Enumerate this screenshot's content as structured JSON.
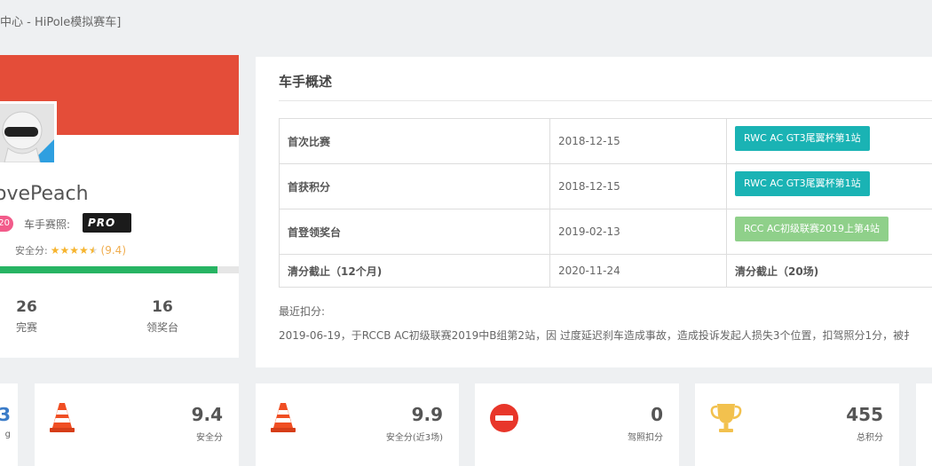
{
  "page_title": "中心 - HiPole模拟赛车]",
  "profile": {
    "username": "ovePeach",
    "level": "20",
    "license_label": "车手赛照:",
    "license_badge": "PRO",
    "safety_label": "安全分:",
    "safety_score_text": "(9.4)",
    "safety_stars": 4.5,
    "progress_fraction": 0.91,
    "stats": [
      {
        "value": "26",
        "label": "完赛"
      },
      {
        "value": "16",
        "label": "领奖台"
      }
    ]
  },
  "overview": {
    "title": "车手概述",
    "rows": [
      {
        "label": "首次比赛",
        "date": "2018-12-15",
        "event": "RWC AC GT3尾翼杯第1站",
        "event_color": "#1ab3b4"
      },
      {
        "label": "首获积分",
        "date": "2018-12-15",
        "event": "RWC AC GT3尾翼杯第1站",
        "event_color": "#1ab3b4"
      },
      {
        "label": "首登领奖台",
        "date": "2019-02-13",
        "event": "RCC AC初级联赛2019上第4站",
        "event_color": "#8fd08a"
      },
      {
        "label": "清分截止（12个月)",
        "date": "2020-11-24",
        "note": "清分截止（20场)"
      }
    ],
    "recent_label": "最近扣分:",
    "recent_text": "2019-06-19，于RCCB AC初级联赛2019中B组第2站，因 过度延迟刹车造成事故，造成投诉发起人损失3个位置，扣驾照分1分，被扌"
  },
  "bottom_cards": [
    {
      "value": "3",
      "label": "g",
      "icon": "none"
    },
    {
      "value": "9.4",
      "label": "安全分",
      "icon": "traffic-cone-icon"
    },
    {
      "value": "9.9",
      "label": "安全分(近3场)",
      "icon": "traffic-cone-icon"
    },
    {
      "value": "0",
      "label": "驾照扣分",
      "icon": "no-entry-icon"
    },
    {
      "value": "455",
      "label": "总积分",
      "icon": "trophy-icon"
    }
  ],
  "colors": {
    "banner": "#e44d39",
    "progress": "#27b463",
    "star": "#f6b42f",
    "level_badge": "#f25b8a"
  }
}
